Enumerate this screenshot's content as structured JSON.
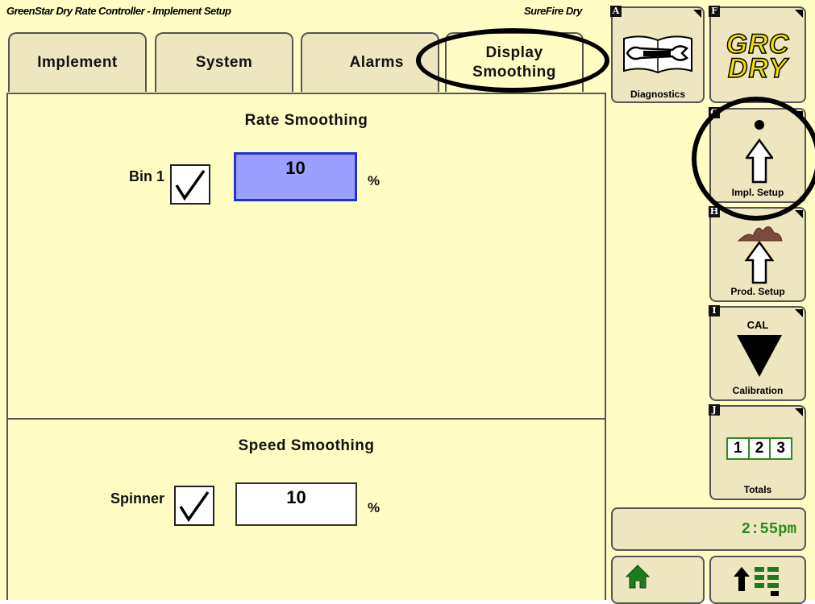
{
  "header": {
    "title": "GreenStar Dry Rate Controller - Implement Setup",
    "product": "SureFire Dry"
  },
  "tabs": [
    {
      "label": "Implement"
    },
    {
      "label": "System"
    },
    {
      "label": "Alarms"
    },
    {
      "label": "Display Smoothing",
      "active": true
    }
  ],
  "rate_smoothing": {
    "title": "Rate Smoothing",
    "label": "Bin 1",
    "checked": true,
    "value": "10",
    "unit": "%"
  },
  "speed_smoothing": {
    "title": "Speed Smoothing",
    "label": "Spinner",
    "checked": true,
    "value": "10",
    "unit": "%"
  },
  "softkeys": [
    {
      "key": "A",
      "label": "Diagnostics",
      "icon": "wrench-book-icon"
    },
    {
      "key": "F",
      "label": "GRC DRY",
      "line1": "GRC",
      "line2": "DRY",
      "icon": "grc-dry-logo"
    },
    {
      "key": "G",
      "label": "Impl. Setup",
      "icon": "up-arrow-icon"
    },
    {
      "key": "H",
      "label": "Prod. Setup",
      "icon": "up-arrow-icon"
    },
    {
      "key": "I",
      "label": "Calibration",
      "top_text": "CAL",
      "icon": "down-triangle-icon"
    },
    {
      "key": "J",
      "label": "Totals",
      "digits": [
        "1",
        "2",
        "3"
      ],
      "icon": "counter-icon"
    }
  ],
  "clock": "2:55pm",
  "nav": {
    "home_icon": "home-icon",
    "menu_icon": "menu-up-icon"
  },
  "colors": {
    "background": "#fffdc4",
    "button": "#eee6bf",
    "active_input": "#9aa0ff",
    "active_border": "#2233cc",
    "clock_text": "#2d8a1f",
    "logo_yellow": "#f2e200"
  }
}
